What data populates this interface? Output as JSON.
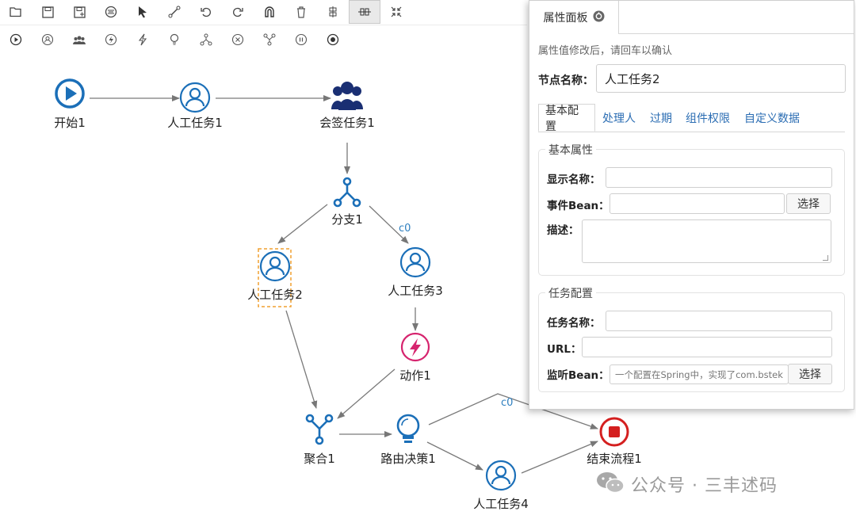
{
  "toolbar_top": {
    "tools": [
      "folder-open-icon",
      "save-icon",
      "save-as-icon",
      "align-center-icon",
      "pointer-icon",
      "connector-icon",
      "undo-icon",
      "redo-icon",
      "magnet-icon",
      "trash-icon",
      "distribute-vertical-icon",
      "distribute-horizontal-icon",
      "collapse-icon"
    ],
    "active_tool": "distribute-horizontal-icon"
  },
  "toolbar_palette": {
    "tools": [
      "start-node-icon",
      "task-node-icon",
      "countersign-node-icon",
      "action-node-icon",
      "subprocess-node-icon",
      "decision-node-icon",
      "fork-node-icon",
      "end-terminate-icon",
      "join-node-icon",
      "end-error-icon",
      "end-node-icon"
    ]
  },
  "diagram": {
    "nodes": [
      {
        "id": "start1",
        "label": "开始1",
        "type": "start"
      },
      {
        "id": "task1",
        "label": "人工任务1",
        "type": "task"
      },
      {
        "id": "sign1",
        "label": "会签任务1",
        "type": "countersign"
      },
      {
        "id": "fork1",
        "label": "分支1",
        "type": "fork"
      },
      {
        "id": "task2",
        "label": "人工任务2",
        "type": "task",
        "selected": true
      },
      {
        "id": "task3",
        "label": "人工任务3",
        "type": "task"
      },
      {
        "id": "action1",
        "label": "动作1",
        "type": "action"
      },
      {
        "id": "join1",
        "label": "聚合1",
        "type": "join"
      },
      {
        "id": "decision1",
        "label": "路由决策1",
        "type": "decision"
      },
      {
        "id": "end1",
        "label": "结束流程1",
        "type": "end"
      },
      {
        "id": "task4",
        "label": "人工任务4",
        "type": "task"
      }
    ],
    "condition_labels": [
      "c0",
      "c0"
    ],
    "colors": {
      "blue": "#1b6fb8",
      "navy": "#1a2f73",
      "pink": "#d6246e",
      "red": "#d41f1f",
      "selection": "#f0a030",
      "edge": "#777777"
    }
  },
  "panel": {
    "tab_title": "属性面板",
    "hint": "属性值修改后，请回车以确认",
    "node_name_label": "节点名称：",
    "node_name_value": "人工任务2",
    "subtabs": [
      "基本配置",
      "处理人",
      "过期",
      "组件权限",
      "自定义数据"
    ],
    "active_subtab": "基本配置",
    "basic": {
      "legend": "基本属性",
      "display_name_label": "显示名称：",
      "display_name_value": "",
      "event_bean_label": "事件Bean：",
      "event_bean_value": "",
      "select_label": "选择",
      "desc_label": "描述：",
      "desc_value": ""
    },
    "task": {
      "legend": "任务配置",
      "task_name_label": "任务名称：",
      "task_name_value": "",
      "url_label": "URL：",
      "url_value": "",
      "listener_label": "监听Bean：",
      "listener_placeholder": "一个配置在Spring中，实现了com.bstek",
      "select_label": "选择"
    }
  },
  "watermark": {
    "text": "公众号 · 三丰述码"
  }
}
